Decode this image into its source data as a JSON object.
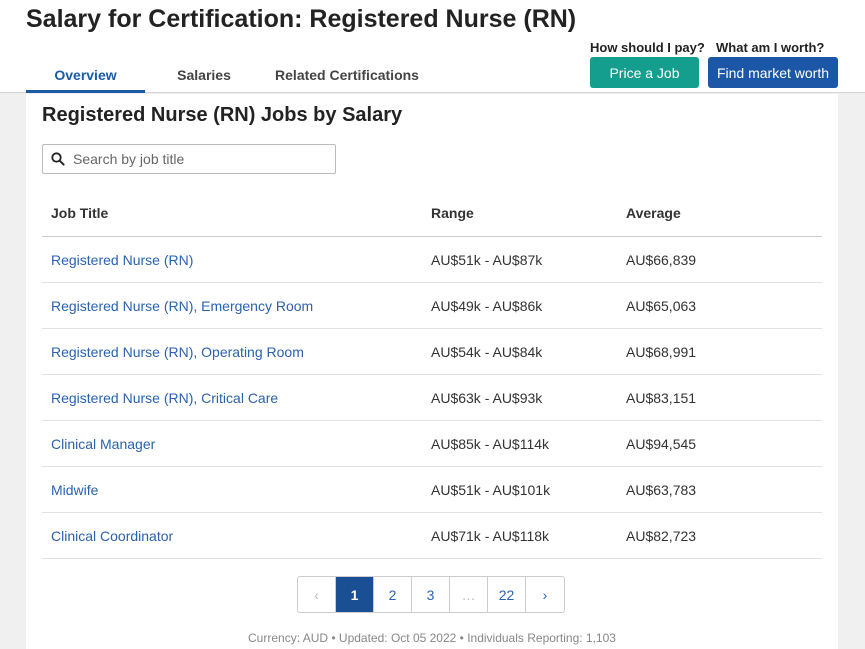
{
  "header": {
    "title": "Salary for Certification: Registered Nurse (RN)",
    "tabs": [
      {
        "label": "Overview",
        "active": true
      },
      {
        "label": "Salaries",
        "active": false
      },
      {
        "label": "Related Certifications",
        "active": false
      }
    ],
    "cta": {
      "price_question": "How should I pay?",
      "price_button": "Price a Job",
      "market_question": "What am I worth?",
      "market_button": "Find market worth"
    }
  },
  "section": {
    "title": "Registered Nurse (RN) Jobs by Salary",
    "search_placeholder": "Search by job title"
  },
  "table": {
    "headers": [
      "Job Title",
      "Range",
      "Average"
    ],
    "rows": [
      {
        "title": "Registered Nurse (RN)",
        "range": "AU$51k - AU$87k",
        "average": "AU$66,839"
      },
      {
        "title": "Registered Nurse (RN), Emergency Room",
        "range": "AU$49k - AU$86k",
        "average": "AU$65,063"
      },
      {
        "title": "Registered Nurse (RN), Operating Room",
        "range": "AU$54k - AU$84k",
        "average": "AU$68,991"
      },
      {
        "title": "Registered Nurse (RN), Critical Care",
        "range": "AU$63k - AU$93k",
        "average": "AU$83,151"
      },
      {
        "title": "Clinical Manager",
        "range": "AU$85k - AU$114k",
        "average": "AU$94,545"
      },
      {
        "title": "Midwife",
        "range": "AU$51k - AU$101k",
        "average": "AU$63,783"
      },
      {
        "title": "Clinical Coordinator",
        "range": "AU$71k - AU$118k",
        "average": "AU$82,723"
      }
    ]
  },
  "pagination": {
    "prev": "‹",
    "pages": [
      "1",
      "2",
      "3"
    ],
    "ellipsis": "…",
    "last": "22",
    "next": "›",
    "current": "1"
  },
  "footer": {
    "note": "Currency: AUD • Updated: Oct 05 2022 • Individuals Reporting: 1,103"
  },
  "colors": {
    "accent": "#1a5aa8",
    "price_button": "#149e8d",
    "market_button": "#1b57a6",
    "link": "#2a62b0"
  }
}
